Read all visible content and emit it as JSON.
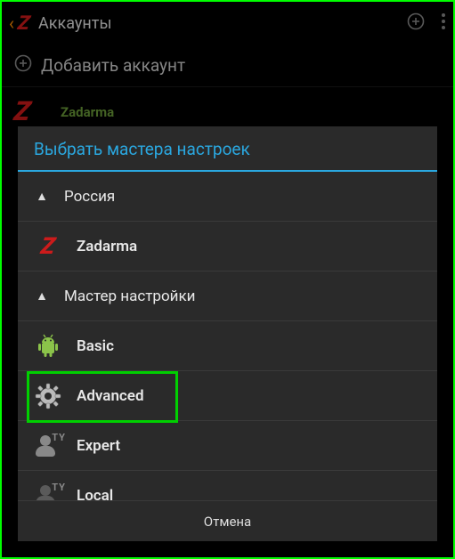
{
  "header": {
    "title": "Аккаунты"
  },
  "add_row": {
    "label": "Добавить аккаунт"
  },
  "bg_account": {
    "name": "Zadarma"
  },
  "dialog": {
    "title": "Выбрать мастера настроек",
    "group_country": "Россия",
    "items_country": [
      {
        "label": "Zadarma"
      }
    ],
    "group_wizard": "Мастер настройки",
    "items_wizard": [
      {
        "label": "Basic"
      },
      {
        "label": "Advanced"
      },
      {
        "label": "Expert"
      },
      {
        "label": "Local"
      }
    ],
    "cancel": "Отмена"
  },
  "highlighted_item": "Advanced"
}
